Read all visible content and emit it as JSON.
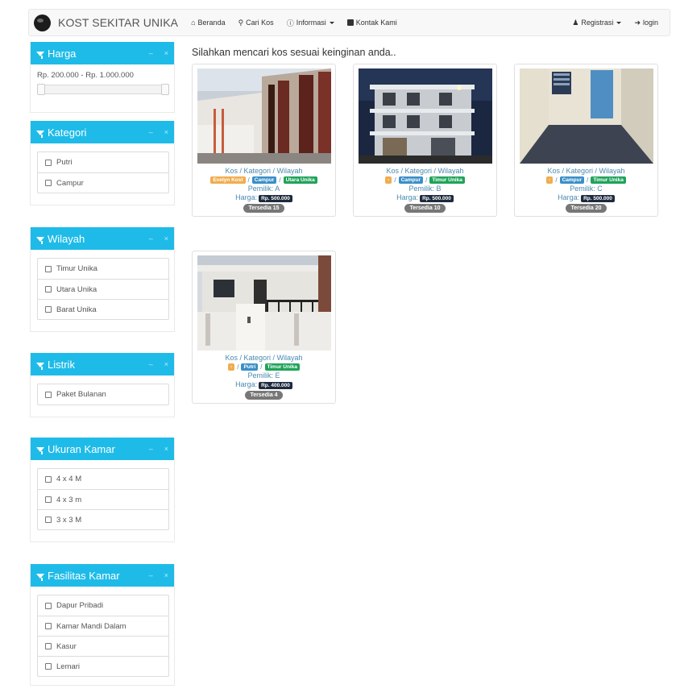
{
  "brand": "KOST SEKITAR UNIKA",
  "nav": {
    "beranda": "Beranda",
    "cari_kos": "Cari Kos",
    "informasi": "Informasi",
    "kontak": "Kontak Kami",
    "registrasi": "Registrasi",
    "login": "login"
  },
  "heading": "Silahkan mencari kos sesuai keinginan anda..",
  "filters": {
    "harga": {
      "title": "Harga",
      "range_text": "Rp. 200.000 - Rp. 1.000.000"
    },
    "kategori": {
      "title": "Kategori",
      "items": [
        "Putri",
        "Campur"
      ]
    },
    "wilayah": {
      "title": "Wilayah",
      "items": [
        "Timur Unika",
        "Utara Unika",
        "Barat Unika"
      ]
    },
    "listrik": {
      "title": "Listrik",
      "items": [
        "Paket Bulanan"
      ]
    },
    "ukuran": {
      "title": "Ukuran Kamar",
      "items": [
        "4 x 4 M",
        "4 x 3 m",
        "3 x 3 M"
      ]
    },
    "fasilitas": {
      "title": "Fasilitas Kamar",
      "items": [
        "Dapur Pribadi",
        "Kamar Mandi Dalam",
        "Kasur",
        "Lemari"
      ]
    }
  },
  "cards": [
    {
      "cat": "Kos / Kategori / Wilayah",
      "tag1": "Evelyn Kost",
      "tag2": "Campur",
      "tag3": "Utara Unika",
      "pemilik": "Pemilik: A",
      "harga_label": "Harga:",
      "price": "Rp. 500.000",
      "tersedia": "Tersedia 15"
    },
    {
      "cat": "Kos / Kategori / Wilayah",
      "tag1": "-",
      "tag2": "Campur",
      "tag3": "Timur Unika",
      "pemilik": "Pemilik: B",
      "harga_label": "Harga:",
      "price": "Rp. 500.000",
      "tersedia": "Tersedia 10"
    },
    {
      "cat": "Kos / Kategori / Wilayah",
      "tag1": "-",
      "tag2": "Campur",
      "tag3": "Timur Unika",
      "pemilik": "Pemilik: C",
      "harga_label": "Harga:",
      "price": "Rp. 500.000",
      "tersedia": "Tersedia 20"
    },
    {
      "cat": "Kos / Kategori / Wilayah",
      "tag1": "-",
      "tag2": "Putri",
      "tag3": "Timur Unika",
      "pemilik": "Pemilik: E",
      "harga_label": "Harga:",
      "price": "Rp. 400.000",
      "tersedia": "Tersedia 4"
    }
  ],
  "colors": {
    "panel_header": "#1fbbe8",
    "badge_orange": "#f0ad4e",
    "badge_blue": "#3a8fc7",
    "badge_green": "#20a35a",
    "price_bg": "#1d2a3e"
  }
}
